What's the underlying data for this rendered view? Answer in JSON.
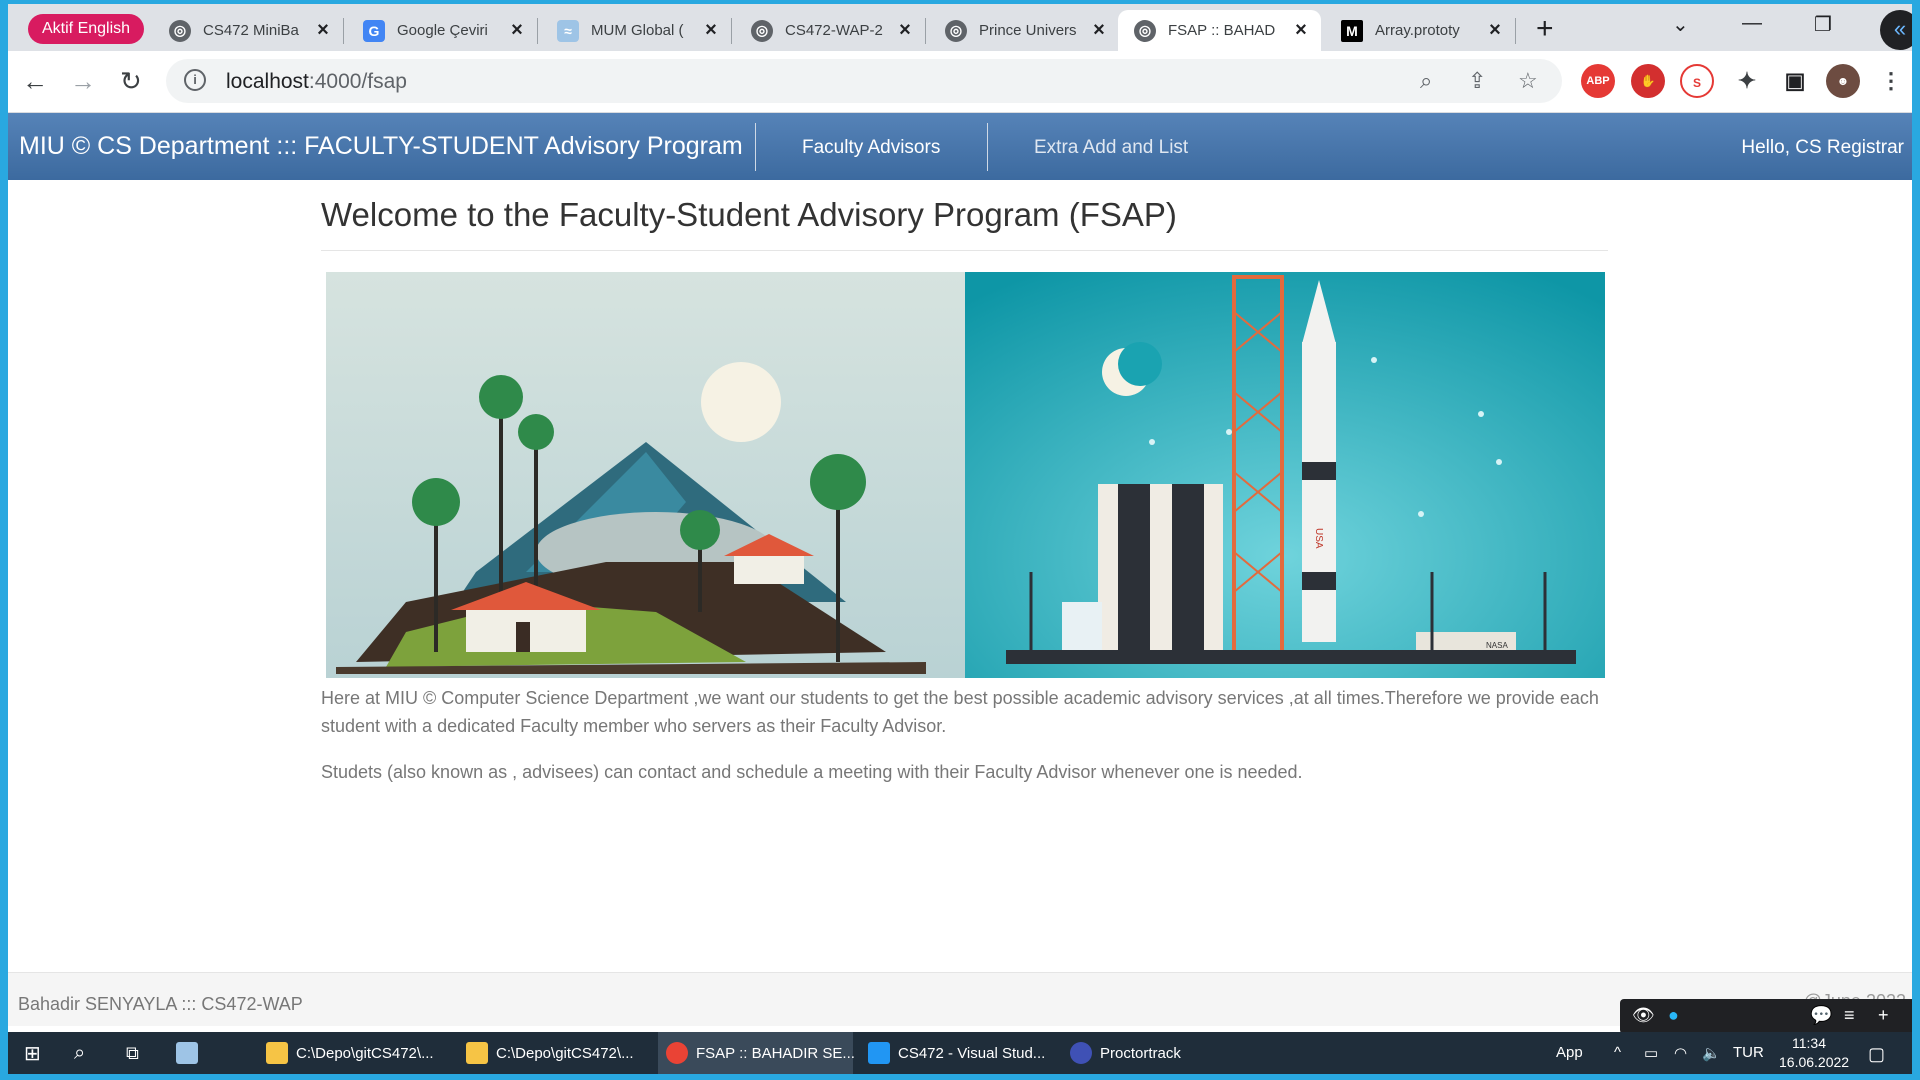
{
  "browser": {
    "tab_group_label": "Aktif English",
    "tabs": [
      {
        "title": "CS472 MiniBa",
        "active": false
      },
      {
        "title": "Google Çeviri",
        "active": false
      },
      {
        "title": "MUM Global (",
        "active": false
      },
      {
        "title": "CS472-WAP-2",
        "active": false
      },
      {
        "title": "Prince Univers",
        "active": false
      },
      {
        "title": "FSAP :: BAHAD",
        "active": true
      },
      {
        "title": "Array.prototy",
        "active": false
      }
    ],
    "url_host": "localhost",
    "url_rest": ":4000/fsap",
    "extensions": [
      "ABP",
      "stop-sign",
      "circle-extension",
      "puzzle",
      "reader-mode",
      "profile-avatar"
    ]
  },
  "app": {
    "brand": "MIU © CS Department ::: FACULTY-STUDENT Advisory Program",
    "nav": {
      "faculty_advisors": "Faculty Advisors",
      "extra": "Extra Add and List"
    },
    "greeting": "Hello, CS Registrar"
  },
  "main": {
    "title": "Welcome to the Faculty-Student Advisory Program (FSAP)",
    "paragraph1": "Here at MIU © Computer Science Department ,we want our students to get the best possible academic advisory services ,at all times.Therefore we provide each student with a dedicated Faculty member who servers as their Faculty Advisor.",
    "paragraph2": "Studets (also known as , advisees) can contact and schedule a meeting with their Faculty Advisor whenever one is needed.",
    "hero_labels": {
      "rocket": "USA",
      "building": "NASA"
    }
  },
  "footer": {
    "text": "Bahadir SENYAYLA ::: CS472-WAP",
    "right": "@June 2022"
  },
  "taskbar": {
    "items": [
      {
        "label": "C:\\Depo\\gitCS472\\...",
        "active": false
      },
      {
        "label": "C:\\Depo\\gitCS472\\...",
        "active": false
      },
      {
        "label": "FSAP :: BAHADIR SE...",
        "active": true
      },
      {
        "label": "CS472 - Visual Stud...",
        "active": false
      },
      {
        "label": "Proctortrack",
        "active": false
      }
    ],
    "app_label": "App",
    "language": "TUR",
    "time": "11:34",
    "date": "16.06.2022"
  },
  "colors": {
    "navbar": "#3c6a9f",
    "tab_group": "#d81b60",
    "taskbar": "#1f2d3a",
    "hero_left_sky": "#c9dcd8",
    "hero_right_sky": "#1aa3b1"
  }
}
